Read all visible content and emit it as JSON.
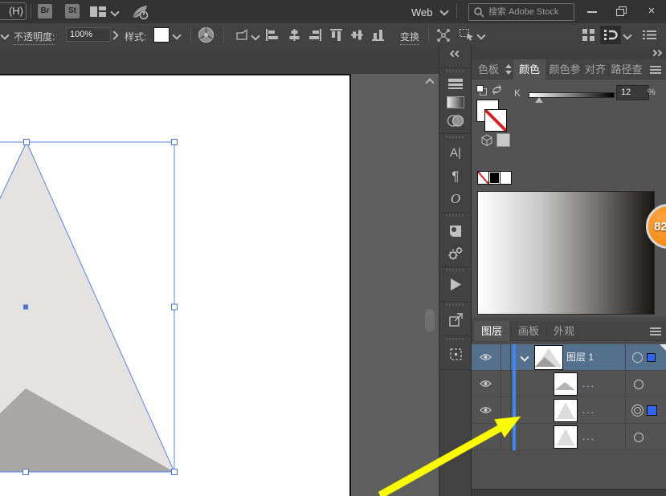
{
  "titlebar": {
    "title_suffix": "(H)",
    "bridge_button": "Br",
    "stock_button": "St",
    "workspace_value": "Web",
    "search_placeholder": "搜索 Adobe Stock"
  },
  "controlbar": {
    "opacity_label": "不透明度:",
    "opacity_value": "100%",
    "style_label": "样式:",
    "transform_label": "变换"
  },
  "color_panel": {
    "tabs": [
      "色板",
      "颜色",
      "颜色参",
      "对齐",
      "路径查"
    ],
    "active_tab": "颜色",
    "channel_label": "K",
    "channel_value": "12",
    "channel_unit": "%"
  },
  "type_icons": {
    "character": "A|",
    "paragraph": "¶",
    "opentype": "O"
  },
  "layers_panel": {
    "tabs": [
      "图层",
      "画板",
      "外观"
    ],
    "active_tab": "图层",
    "rows": [
      {
        "label": "图层 1",
        "visible": true,
        "selected": true,
        "expanded": true
      },
      {
        "label": "...",
        "visible": true
      },
      {
        "label": "...",
        "visible": true,
        "targeted": true
      },
      {
        "label": "...",
        "visible": false
      }
    ]
  },
  "annotation_badge": "82",
  "accent_colors": {
    "selection_blue": "#5b82e8",
    "layer_blue": "#3f87f5",
    "highlight_yellow": "#fcfc00",
    "badge_orange": "#f8931d"
  }
}
